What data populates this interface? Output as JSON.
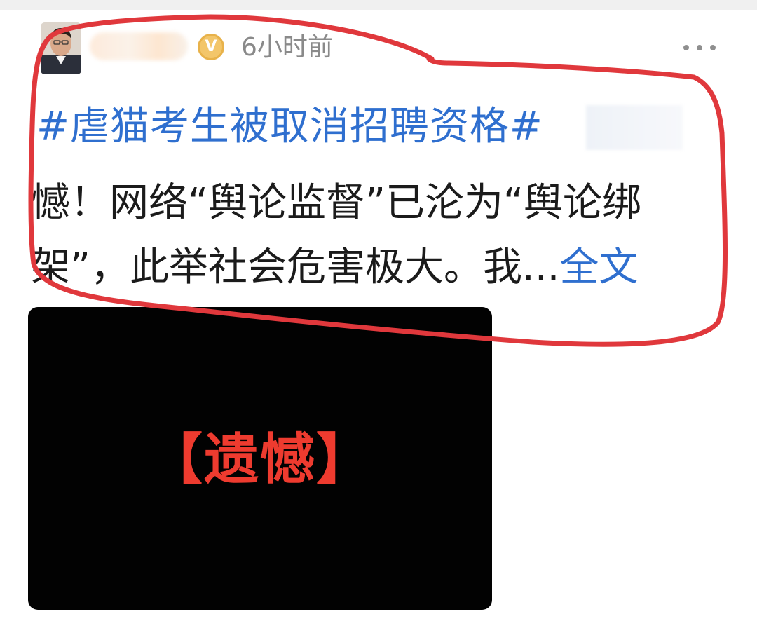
{
  "post": {
    "timestamp": "6小时前",
    "hashtag": "#虐猫考生被取消招聘资格#",
    "body_line_1": "憾！网络“舆论监督”已沦为“舆论绑",
    "body_line_2_text": "架”，此举社会危害极大。我...",
    "full_text_link": "全文",
    "image": {
      "caption": "【遗憾】",
      "caption_color": "#ee3b2f",
      "background_color": "#020202"
    }
  },
  "icons": {
    "verified": "verified-v-icon",
    "more": "more-dots-icon"
  },
  "colors": {
    "link_blue": "#2f6fcf",
    "annotation_red": "#e0383c",
    "timestamp_gray": "#8a8a8a"
  }
}
